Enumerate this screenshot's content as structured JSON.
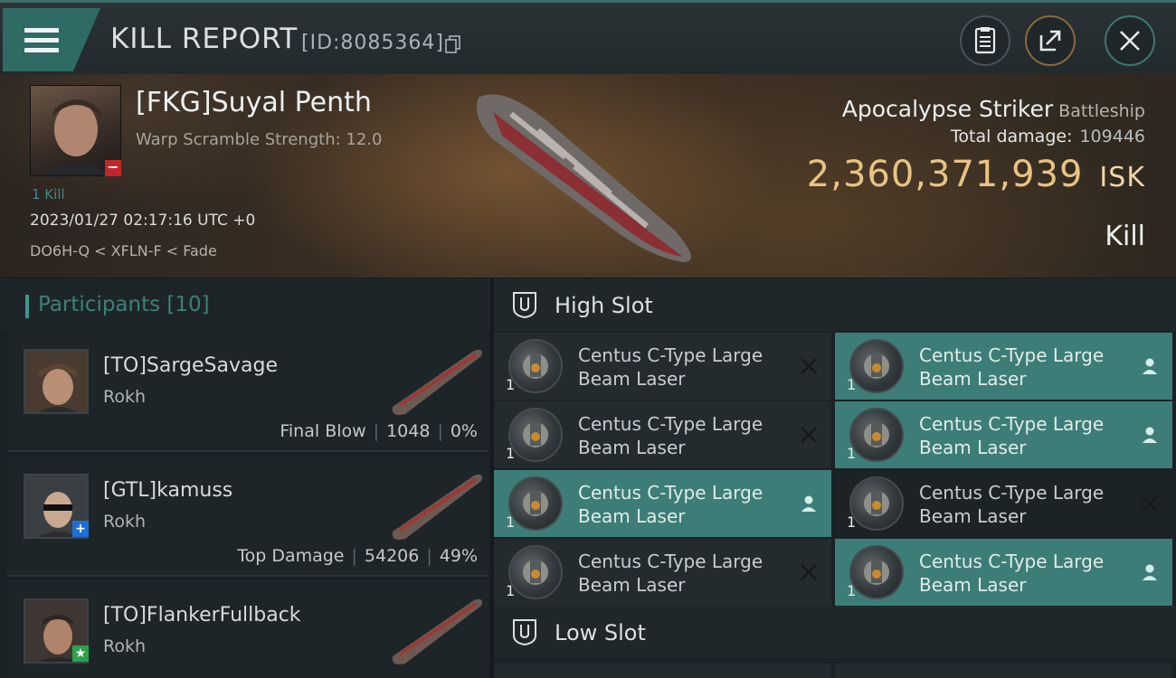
{
  "header": {
    "title": "KILL REPORT",
    "report_id": "[ID:8085364]",
    "icons": [
      "menu-icon",
      "copy-icon",
      "clipboard-icon",
      "share-icon",
      "close-icon"
    ]
  },
  "victim": {
    "name": "[FKG]Suyal Penth",
    "subtitle": "Warp Scramble Strength: 12.0",
    "kill_count": "1 Kill",
    "timestamp": "2023/01/27 02:17:16 UTC +0",
    "location": "DO6H-Q < XFLN-F < Fade",
    "badge": "−"
  },
  "ship": {
    "name": "Apocalypse Striker",
    "class": "Battleship",
    "damage_label": "Total damage:",
    "damage_value": "109446",
    "isk_value": "2,360,371,939",
    "isk_unit": "ISK",
    "result": "Kill"
  },
  "participants": {
    "label": "Participants",
    "count": "[10]",
    "rows": [
      {
        "name": "[TO]SargeSavage",
        "ship": "Rokh",
        "tag": "Final Blow",
        "damage": "1048",
        "percent": "0%",
        "badge": "",
        "badge_color": ""
      },
      {
        "name": "[GTL]kamuss",
        "ship": "Rokh",
        "tag": "Top Damage",
        "damage": "54206",
        "percent": "49%",
        "badge": "+",
        "badge_color": "#1f6fd6"
      },
      {
        "name": "[TO]FlankerFullback",
        "ship": "Rokh",
        "tag": "",
        "damage": "",
        "percent": "",
        "badge": "★",
        "badge_color": "#2ca24b"
      }
    ]
  },
  "slots": {
    "high": {
      "title": "High Slot",
      "items": [
        {
          "qty": "1",
          "name": "Centus C-Type Large Beam Laser",
          "status": "destroyed",
          "style": "normal"
        },
        {
          "qty": "1",
          "name": "Centus C-Type Large Beam Laser",
          "status": "dropped",
          "style": "dropped"
        },
        {
          "qty": "1",
          "name": "Centus C-Type Large Beam Laser",
          "status": "destroyed",
          "style": "normal"
        },
        {
          "qty": "1",
          "name": "Centus C-Type Large Beam Laser",
          "status": "dropped",
          "style": "dropped"
        },
        {
          "qty": "1",
          "name": "Centus C-Type Large Beam Laser",
          "status": "dropped",
          "style": "dropped"
        },
        {
          "qty": "1",
          "name": "Centus C-Type Large Beam Laser",
          "status": "destroyed",
          "style": "dark"
        },
        {
          "qty": "1",
          "name": "Centus C-Type Large Beam Laser",
          "status": "destroyed",
          "style": "normal"
        },
        {
          "qty": "1",
          "name": "Centus C-Type Large Beam Laser",
          "status": "dropped",
          "style": "dropped"
        }
      ]
    },
    "low": {
      "title": "Low Slot"
    }
  },
  "colors": {
    "accent": "#3d7d77",
    "isk": "#e9c383",
    "destroyed_badge": "#c2262a"
  }
}
